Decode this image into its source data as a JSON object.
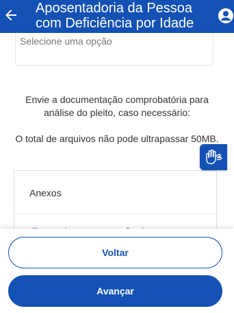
{
  "header": {
    "title": "Aposentadoria da Pessoa com Deficiência por Idade",
    "back_icon": "arrow-left-icon",
    "user_icon": "user-account-icon",
    "color": "#1351b4"
  },
  "form": {
    "select_placeholder": "Selecione uma opção",
    "instructions": "Envie a documentação comprobatória para análise do pleito, caso necessário:",
    "limit_text": "O total de arquivos não pode ultrapassar 50MB."
  },
  "attachments": {
    "title": "Anexos",
    "first_item": "Termo de representação de..."
  },
  "accessibility": {
    "icon": "libras-hands-icon"
  },
  "actions": {
    "back_label": "Voltar",
    "next_label": "Avançar"
  }
}
